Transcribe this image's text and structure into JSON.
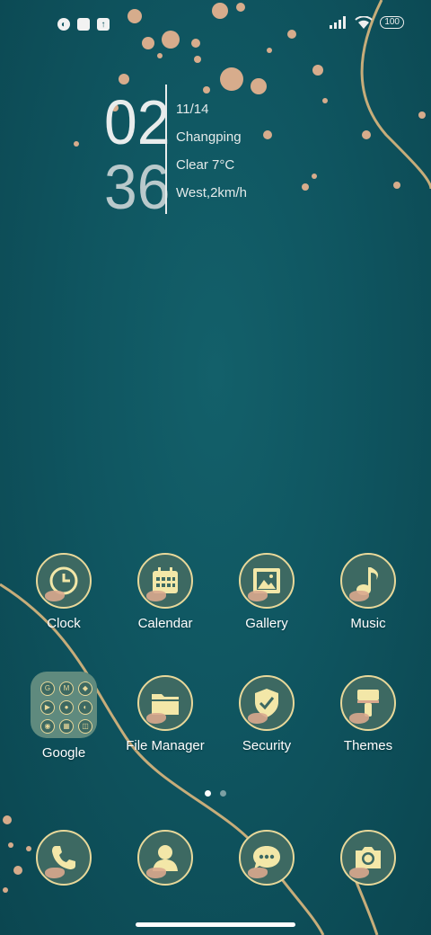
{
  "status_bar": {
    "left_icons": [
      "notification-icon",
      "square-notification-icon",
      "upload-icon"
    ],
    "right_icons": [
      "signal-icon",
      "wifi-icon",
      "battery-icon"
    ],
    "battery": "100"
  },
  "clock_widget": {
    "hour": "02",
    "minute": "36",
    "date": "11/14",
    "location": "Changping",
    "weather": "Clear 7°C",
    "wind": "West,2km/h"
  },
  "apps_row1": [
    {
      "label": "Clock",
      "icon": "clock-icon"
    },
    {
      "label": "Calendar",
      "icon": "calendar-icon"
    },
    {
      "label": "Gallery",
      "icon": "gallery-icon"
    },
    {
      "label": "Music",
      "icon": "music-icon"
    }
  ],
  "apps_row2": [
    {
      "label": "Google",
      "icon": "google-folder-icon"
    },
    {
      "label": "File Manager",
      "icon": "folder-icon"
    },
    {
      "label": "Security",
      "icon": "shield-icon"
    },
    {
      "label": "Themes",
      "icon": "paint-brush-icon"
    }
  ],
  "google_folder_apps": [
    "G",
    "M",
    "◆",
    "▶",
    "●",
    "◐",
    "◉",
    "▦",
    "◫"
  ],
  "dock": [
    {
      "icon": "phone-icon"
    },
    {
      "icon": "contacts-icon"
    },
    {
      "icon": "messages-icon"
    },
    {
      "icon": "camera-icon"
    }
  ],
  "page_indicator": {
    "pages": 2,
    "active": 1
  },
  "colors": {
    "background": "#0f5560",
    "icon_fill": "#3d6962",
    "icon_accent": "#e8d89a",
    "splatter": "#e8b490"
  }
}
